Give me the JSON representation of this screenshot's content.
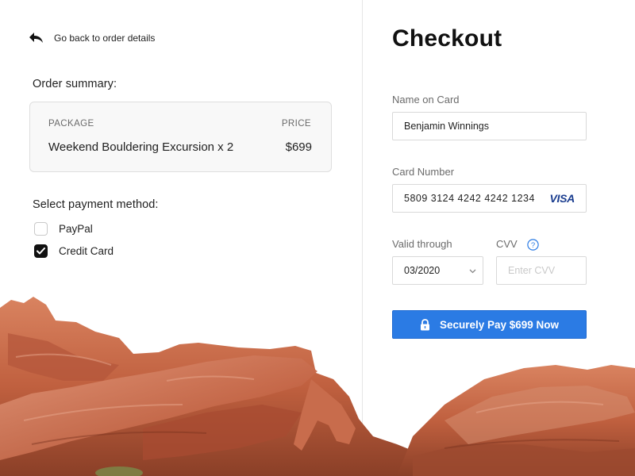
{
  "left": {
    "back_link_label": "Go back to order details",
    "order_summary_title": "Order summary:",
    "summary": {
      "package_header": "PACKAGE",
      "price_header": "PRICE",
      "item_name": "Weekend Bouldering Excursion x 2",
      "item_price": "$699"
    },
    "payment_method_title": "Select payment method:",
    "payment_methods": [
      {
        "label": "PayPal",
        "checked": false
      },
      {
        "label": "Credit Card",
        "checked": true
      }
    ]
  },
  "checkout": {
    "title": "Checkout",
    "name_label": "Name on Card",
    "name_value": "Benjamin Winnings",
    "card_number_label": "Card Number",
    "card_number_value": "5809 3124 4242 4242 1234",
    "card_brand": "VISA",
    "valid_through_label": "Valid through",
    "valid_through_value": "03/2020",
    "cvv_label": "CVV",
    "cvv_placeholder": "Enter CVV",
    "pay_button_label": "Securely Pay $699 Now"
  },
  "icons": {
    "back": "reply-arrow-icon",
    "lock": "lock-icon",
    "help": "question-circle-icon",
    "chevron": "chevron-down-icon"
  },
  "colors": {
    "accent": "#2b7be4",
    "rock": "#c96a4a",
    "visa_blue": "#1a3d8f"
  }
}
